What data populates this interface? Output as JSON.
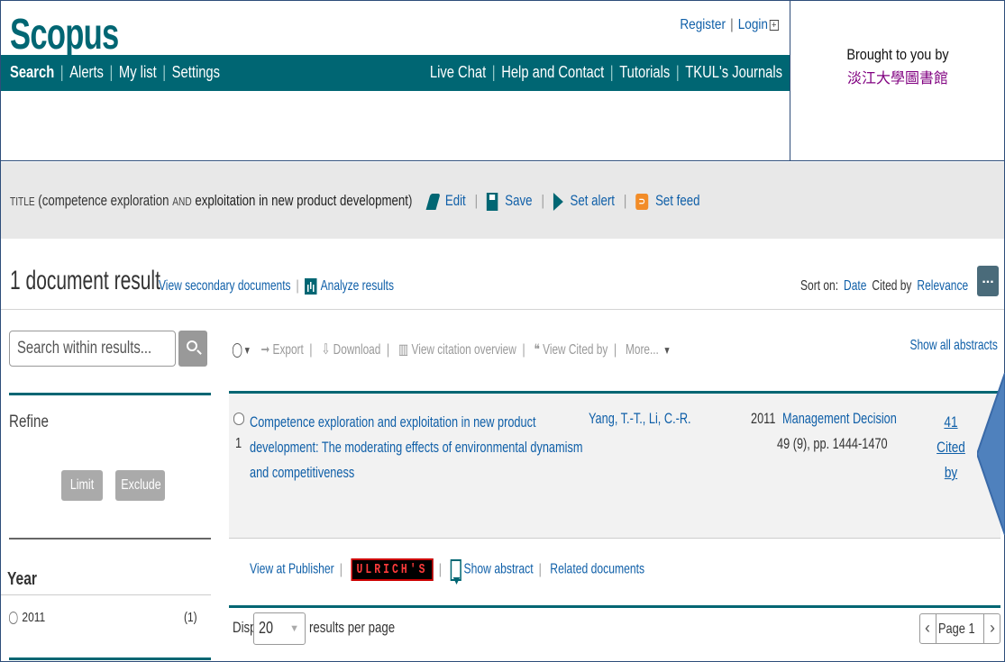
{
  "header": {
    "logo": "Scopus",
    "register": "Register",
    "login": "Login",
    "nav_left": [
      "Search",
      "Alerts",
      "My list",
      "Settings"
    ],
    "nav_right": [
      "Live Chat",
      "Help and Contact",
      "Tutorials",
      "TKUL's Journals"
    ],
    "brought_by": "Brought to you by",
    "institution": "淡江大學圖書館"
  },
  "query": {
    "field": "TITLE",
    "open": "(",
    "term1": "competence exploration",
    "op": "AND",
    "term2": "exploitation in new product development",
    "close": ")",
    "actions": [
      "Edit",
      "Save",
      "Set alert",
      "Set feed"
    ]
  },
  "results": {
    "count_text": "1 document result",
    "secondary": "View secondary documents",
    "analyze": "Analyze results",
    "sort_label": "Sort on:",
    "sort_date": "Date",
    "sort_cited": "Cited by",
    "sort_relevance": "Relevance",
    "more": "..."
  },
  "sidebar": {
    "search_placeholder": "Search within results...",
    "refine": "Refine",
    "limit_to": "Limit to",
    "exclude": "Exclude",
    "year_label": "Year",
    "year_value": "2011",
    "year_count": "(1)"
  },
  "toolbar": {
    "export": "Export",
    "download": "Download",
    "citation": "View citation overview",
    "cited_by": "View Cited by",
    "more": "More...",
    "show_all": "Show all abstracts"
  },
  "document": {
    "number": "1",
    "title": "Competence exploration and exploitation in new product development: The moderating effects of environmental dynamism and competitiveness",
    "authors": "Yang, T.-T., Li, C.-R.",
    "year": "2011",
    "source": "Management Decision",
    "volume": "49 (9), pp. 1444-1470",
    "cited_count": "41",
    "cited_label1": "Cited",
    "cited_label2": "by",
    "view_publisher": "View at Publisher",
    "ulrich": "ULRICH'S",
    "show_abstract": "Show abstract",
    "related": "Related documents"
  },
  "pagination": {
    "display": "Display",
    "per_page_value": "20",
    "per_page_suffix": "results per page",
    "page": "Page 1"
  },
  "colors": {
    "brand": "#006673",
    "link": "#0f5fa8",
    "callout": "#4f81bd"
  }
}
